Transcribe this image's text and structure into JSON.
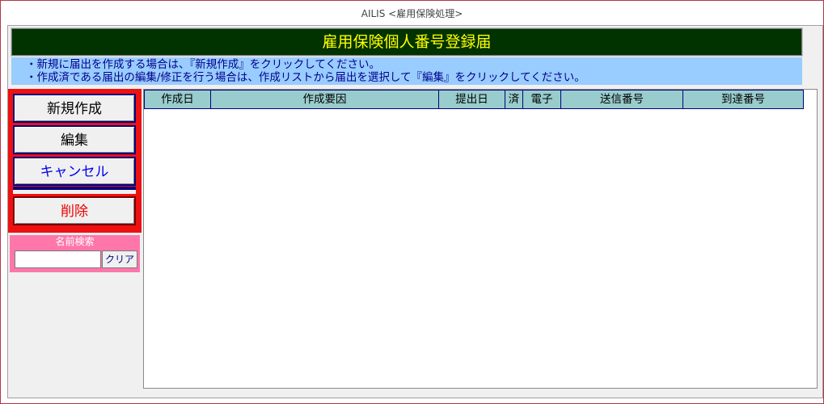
{
  "window": {
    "title": "AILIS <雇用保険処理>"
  },
  "banner": {
    "title": "雇用保険個人番号登録届"
  },
  "info": {
    "line1": "・新規に届出を作成する場合は、『新規作成』をクリックしてください。",
    "line2": "・作成済である届出の編集/修正を行う場合は、作成リストから届出を選択して『編集』をクリックしてください。"
  },
  "buttons": {
    "new": "新規作成",
    "edit": "編集",
    "cancel": "キャンセル",
    "delete": "削除"
  },
  "search": {
    "label": "名前検索",
    "value": "",
    "clear": "クリア"
  },
  "list": {
    "columns": [
      "作成日",
      "作成要因",
      "提出日",
      "済",
      "電子",
      "送信番号",
      "到達番号"
    ],
    "rows": []
  },
  "colors": {
    "banner_bg": "#003300",
    "banner_text": "#ffff00",
    "info_bg": "#99ccff",
    "button_panel": "#ee1111",
    "search_panel": "#ff77aa",
    "header_bg": "#99cccc"
  }
}
